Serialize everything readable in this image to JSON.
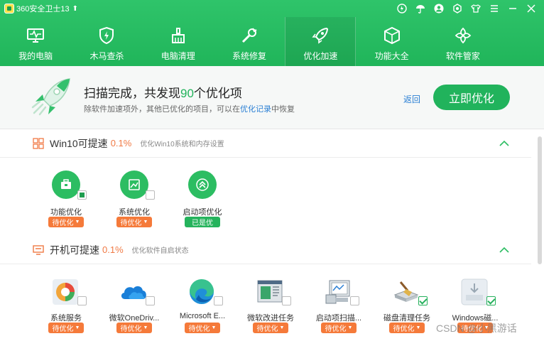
{
  "titlebar": {
    "app_title": "360安全卫士13",
    "up_icon": "arrow-up-icon",
    "controls": [
      "shield-badge-icon",
      "umbrella-icon",
      "user-avatar-icon",
      "gear-icon",
      "shirt-icon",
      "menu-icon",
      "minimize-icon",
      "close-icon"
    ]
  },
  "nav": {
    "items": [
      {
        "label": "我的电脑",
        "icon": "monitor-icon"
      },
      {
        "label": "木马查杀",
        "icon": "shield-bolt-icon"
      },
      {
        "label": "电脑清理",
        "icon": "broom-icon"
      },
      {
        "label": "系统修复",
        "icon": "wrench-icon"
      },
      {
        "label": "优化加速",
        "icon": "rocket-icon",
        "active": true
      },
      {
        "label": "功能大全",
        "icon": "cube-icon"
      },
      {
        "label": "软件管家",
        "icon": "flower-icon"
      }
    ]
  },
  "banner": {
    "title_prefix": "扫描完成，共发现",
    "count": "90",
    "title_suffix": "个优化项",
    "sub_prefix": "除软件加速项外，其他已优化的项目，可以在",
    "sub_link": "优化记录",
    "sub_suffix": "中恢复",
    "back_label": "返回",
    "action_label": "立即优化"
  },
  "sections": [
    {
      "title": "Win10可提速",
      "percent": "0.1%",
      "desc": "优化Win10系统和内存设置",
      "items": [
        {
          "label": "功能优化",
          "status": "待优化",
          "icon": "toolbox-icon"
        },
        {
          "label": "系统优化",
          "status": "待优化",
          "icon": "chart-image-icon"
        },
        {
          "label": "启动项优化",
          "status": "已是优",
          "icon": "double-chevron-up-icon"
        }
      ]
    },
    {
      "title": "开机可提速",
      "percent": "0.1%",
      "desc": "优化软件自启状态",
      "items": [
        {
          "label": "系统服务",
          "status": "待优化",
          "icon": "system-service-icon"
        },
        {
          "label": "微软OneDriv...",
          "status": "待优化",
          "icon": "onedrive-icon"
        },
        {
          "label": "Microsoft E...",
          "status": "待优化",
          "icon": "edge-icon"
        },
        {
          "label": "微软改进任务",
          "status": "待优化",
          "icon": "improvement-task-icon"
        },
        {
          "label": "启动项扫描...",
          "status": "待优化",
          "icon": "startup-scan-icon"
        },
        {
          "label": "磁盘清理任务",
          "status": "待优化",
          "icon": "disk-cleanup-icon"
        },
        {
          "label": "Windows磁...",
          "status": "待优化",
          "icon": "windows-disk-icon"
        }
      ]
    }
  ],
  "watermark": "CSDN @小黑游话",
  "colors": {
    "brand_green": "#21b35c",
    "accent_orange": "#f57a3a",
    "link_blue": "#2a7fd4"
  }
}
